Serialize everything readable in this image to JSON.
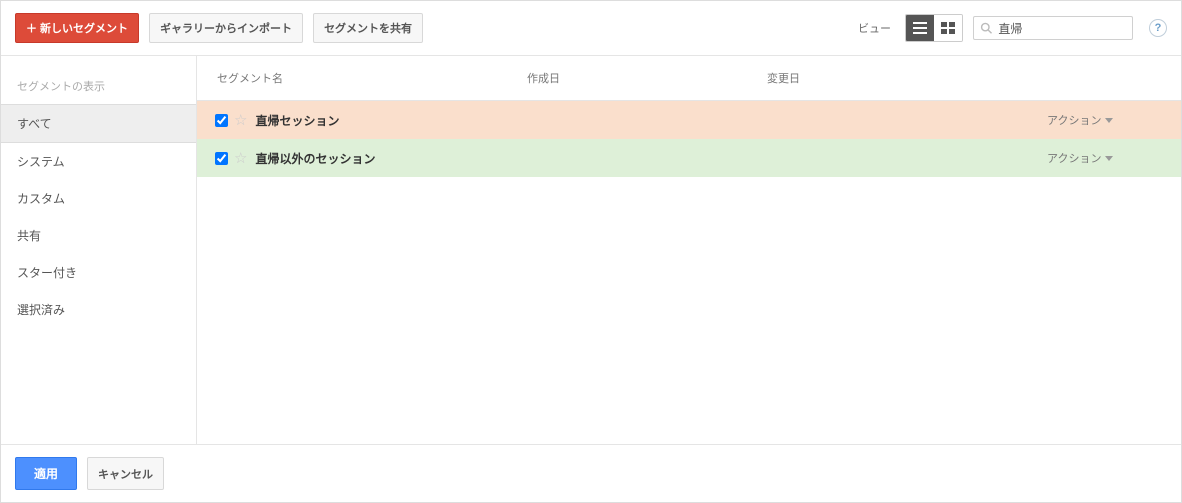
{
  "toolbar": {
    "new_segment": "＋ 新しいセグメント",
    "import_gallery": "ギャラリーからインポート",
    "share_segment": "セグメントを共有",
    "view_label": "ビュー",
    "search_value": "直帰"
  },
  "sidebar": {
    "title": "セグメントの表示",
    "items": [
      {
        "label": "すべて",
        "active": true
      },
      {
        "label": "システム",
        "active": false
      },
      {
        "label": "カスタム",
        "active": false
      },
      {
        "label": "共有",
        "active": false
      },
      {
        "label": "スター付き",
        "active": false
      },
      {
        "label": "選択済み",
        "active": false
      }
    ]
  },
  "table": {
    "headers": {
      "name": "セグメント名",
      "created": "作成日",
      "modified": "変更日"
    },
    "rows": [
      {
        "name": "直帰セッション",
        "checked": true,
        "color": "orange",
        "action": "アクション"
      },
      {
        "name": "直帰以外のセッション",
        "checked": true,
        "color": "green",
        "action": "アクション"
      }
    ]
  },
  "footer": {
    "apply": "適用",
    "cancel": "キャンセル"
  }
}
